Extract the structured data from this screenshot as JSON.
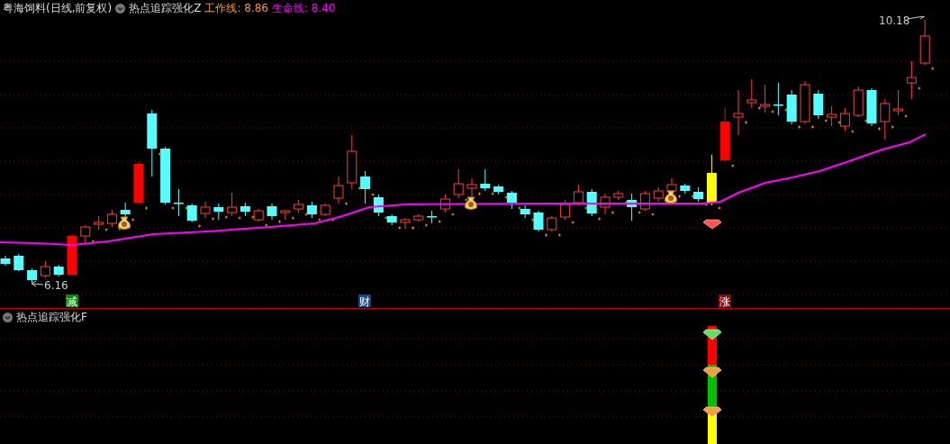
{
  "header": {
    "stock_title": "粤海饲料(日线,前复权)",
    "indicator": "热点追踪强化Z",
    "work_line": "工作线: 8.86",
    "life_line": "生命线: 8.40"
  },
  "main_chart": {
    "high_label": "10.18",
    "low_label": "6.16",
    "signals": [
      {
        "label": "减",
        "color": "#0a8a0a"
      },
      {
        "label": "财",
        "color": "#0b4a8c"
      },
      {
        "label": "涨",
        "color": "#8a0a0a"
      }
    ]
  },
  "lower_pane": {
    "title": "热点追踪强化F",
    "bar_segments": [
      {
        "color": "#ff0000"
      },
      {
        "color": "#00c000"
      },
      {
        "color": "#ffff00"
      }
    ]
  }
}
